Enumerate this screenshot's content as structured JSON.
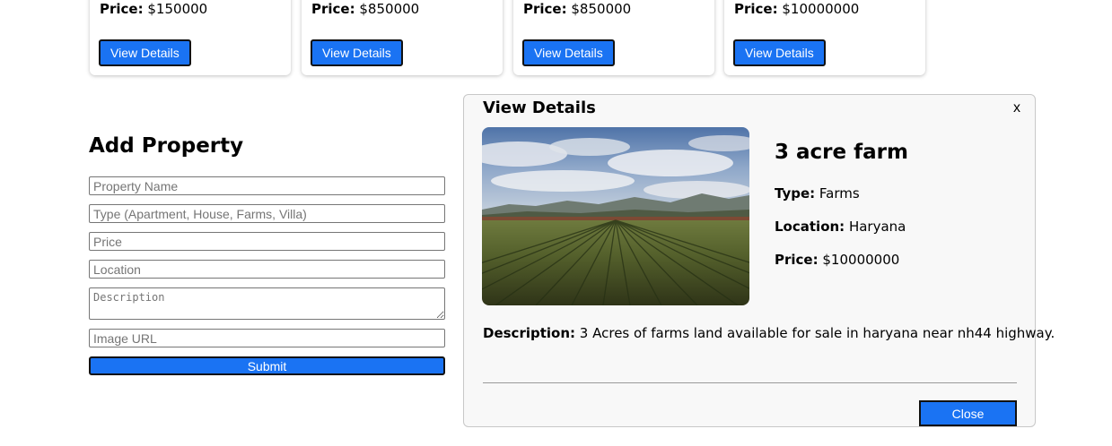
{
  "cards": [
    {
      "price_label": "Price:",
      "price": "$150000",
      "button": "View Details"
    },
    {
      "price_label": "Price:",
      "price": "$850000",
      "button": "View Details"
    },
    {
      "price_label": "Price:",
      "price": "$850000",
      "button": "View Details"
    },
    {
      "price_label": "Price:",
      "price": "$10000000",
      "button": "View Details"
    }
  ],
  "form": {
    "title": "Add Property",
    "name_placeholder": "Property Name",
    "type_placeholder": "Type (Apartment, House, Farms, Villa)",
    "price_placeholder": "Price",
    "location_placeholder": "Location",
    "description_placeholder": "Description",
    "image_placeholder": "Image URL",
    "submit": "Submit"
  },
  "modal": {
    "title": "View Details",
    "close_x": "x",
    "name": "3 acre farm",
    "type_label": "Type:",
    "type": "Farms",
    "location_label": "Location:",
    "location": "Haryana",
    "price_label": "Price:",
    "price": "$10000000",
    "description_label": "Description:",
    "description": "3 Acres of farms land available for sale in haryana near nh44 highway.",
    "close_button": "Close"
  },
  "colors": {
    "button_blue": "#1a73f3",
    "modal_bg": "#f8f8f8"
  },
  "icons": {
    "modal_close": "close-icon"
  }
}
